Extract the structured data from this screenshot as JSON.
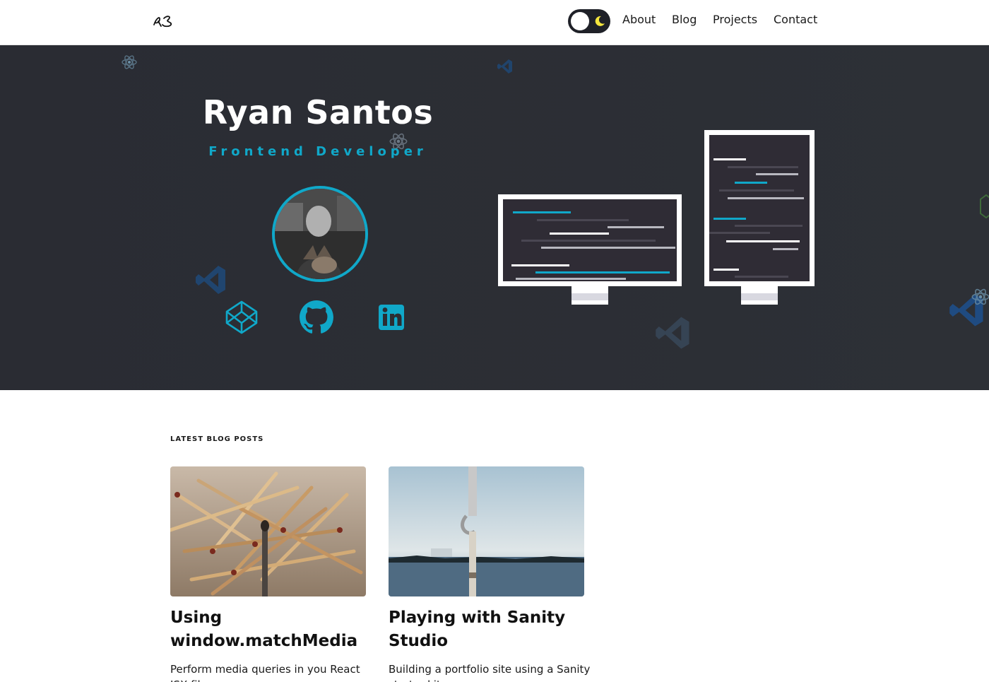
{
  "nav": {
    "logo_text": "RS",
    "links": [
      "About",
      "Blog",
      "Projects",
      "Contact"
    ],
    "theme_toggle": "dark-mode-toggle"
  },
  "hero": {
    "name": "Ryan Santos",
    "role": "Frontend Developer",
    "social": [
      "codepen-icon",
      "github-icon",
      "linkedin-icon"
    ],
    "accent": "#10a8c9",
    "background": "#2b2d33"
  },
  "blog": {
    "section_label": "LATEST BLOG POSTS",
    "posts": [
      {
        "title": "Using window.matchMedia",
        "excerpt": "Perform media queries in you React JSX files"
      },
      {
        "title": "Playing with Sanity Studio",
        "excerpt": "Building a portfolio site using a Sanity starter kit"
      }
    ]
  }
}
